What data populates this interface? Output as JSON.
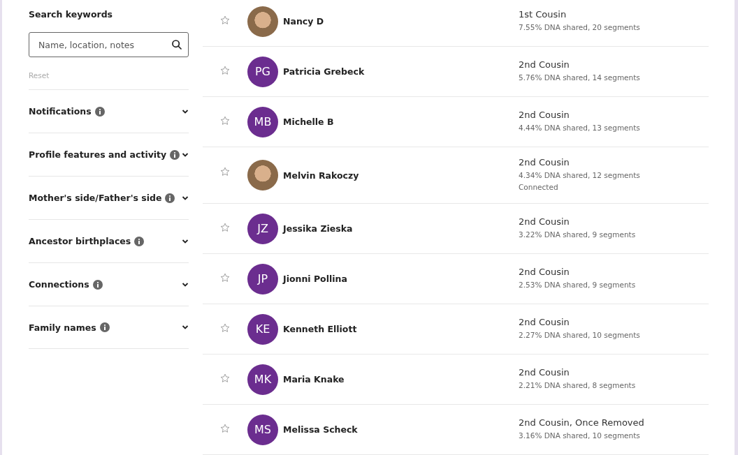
{
  "filters": {
    "title": "Search keywords",
    "search": {
      "placeholder": "Name, location, notes"
    },
    "reset": "Reset",
    "sections": [
      {
        "label": "Notifications",
        "expanded": false
      },
      {
        "label": "Profile features and activity",
        "expanded": false
      },
      {
        "label": "Mother's side/Father's side",
        "expanded": false
      },
      {
        "label": "Ancestor birthplaces",
        "expanded": false
      },
      {
        "label": "Connections",
        "expanded": false
      },
      {
        "label": "Family names",
        "expanded": false
      }
    ]
  },
  "matches": [
    {
      "name": "Nancy D",
      "avatar": {
        "kind": "photo"
      },
      "starred": false,
      "relationship": "1st Cousin",
      "dna": "7.55% DNA shared, 20 segments"
    },
    {
      "name": "Patricia Grebeck",
      "avatar": {
        "kind": "initials",
        "initials": "PG"
      },
      "starred": false,
      "relationship": "2nd Cousin",
      "dna": "5.76% DNA shared, 14 segments"
    },
    {
      "name": "Michelle B",
      "avatar": {
        "kind": "initials",
        "initials": "MB"
      },
      "starred": false,
      "relationship": "2nd Cousin",
      "dna": "4.44% DNA shared, 13 segments"
    },
    {
      "name": "Melvin Rakoczy",
      "avatar": {
        "kind": "photo"
      },
      "starred": false,
      "relationship": "2nd Cousin",
      "dna": "4.34% DNA shared, 12 segments",
      "note": "Connected"
    },
    {
      "name": "Jessika Zieska",
      "avatar": {
        "kind": "initials",
        "initials": "JZ"
      },
      "starred": false,
      "relationship": "2nd Cousin",
      "dna": "3.22% DNA shared, 9 segments"
    },
    {
      "name": "Jionni Pollina",
      "avatar": {
        "kind": "initials",
        "initials": "JP"
      },
      "starred": false,
      "relationship": "2nd Cousin",
      "dna": "2.53% DNA shared, 9 segments"
    },
    {
      "name": "Kenneth Elliott",
      "avatar": {
        "kind": "initials",
        "initials": "KE"
      },
      "starred": false,
      "relationship": "2nd Cousin",
      "dna": "2.27% DNA shared, 10 segments"
    },
    {
      "name": "Maria Knake",
      "avatar": {
        "kind": "initials",
        "initials": "MK"
      },
      "starred": false,
      "relationship": "2nd Cousin",
      "dna": "2.21% DNA shared, 8 segments"
    },
    {
      "name": "Melissa Scheck",
      "avatar": {
        "kind": "initials",
        "initials": "MS"
      },
      "starred": false,
      "relationship": "2nd Cousin, Once Removed",
      "dna": "3.16% DNA shared, 10 segments"
    }
  ]
}
